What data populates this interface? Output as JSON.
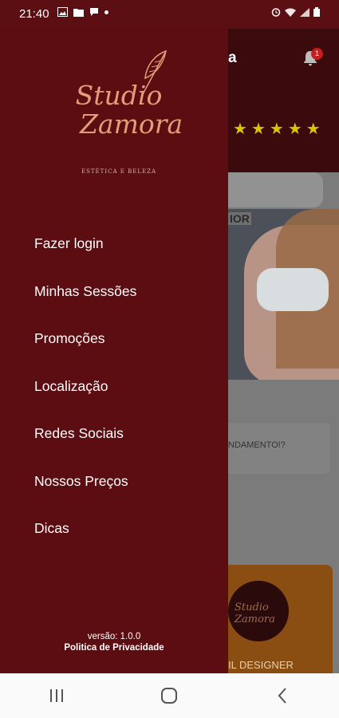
{
  "status_bar": {
    "time": "21:40",
    "left_icons": [
      "image-icon",
      "folder-icon",
      "chat-icon",
      "dot-icon"
    ],
    "right_icons": [
      "alarm-icon",
      "wifi-icon",
      "signal-icon",
      "battery-icon"
    ]
  },
  "background_app": {
    "title_fragment": "a",
    "notification_count": "1",
    "star_count": 5,
    "promo_tag": "IOR",
    "question_fragment": "NDAMENTO!?",
    "card_caption": "IL DESIGNER",
    "card_logo_text": "Studio Zamora"
  },
  "drawer": {
    "logo": {
      "brand_line1": "Studio",
      "brand_line2": "Zamora",
      "tagline": "ESTÉTICA E BELEZA"
    },
    "menu": [
      {
        "label": "Fazer login",
        "name": "menu-item-fazer-login"
      },
      {
        "label": "Minhas Sessões",
        "name": "menu-item-minhas-sessoes"
      },
      {
        "label": "Promoções",
        "name": "menu-item-promocoes"
      },
      {
        "label": "Localização",
        "name": "menu-item-localizacao"
      },
      {
        "label": "Redes Sociais",
        "name": "menu-item-redes-sociais"
      },
      {
        "label": "Nossos Preços",
        "name": "menu-item-nossos-precos"
      },
      {
        "label": "Dicas",
        "name": "menu-item-dicas"
      }
    ],
    "footer": {
      "version": "versão: 1.0.0",
      "privacy": "Politica de Privacidade"
    }
  },
  "nav_bar": {
    "buttons": [
      "recents-icon",
      "home-icon",
      "back-icon"
    ]
  },
  "colors": {
    "drawer": "#5b0d11",
    "logo": "#e09f78",
    "star": "#d9c400",
    "badge": "#c61e1e"
  }
}
